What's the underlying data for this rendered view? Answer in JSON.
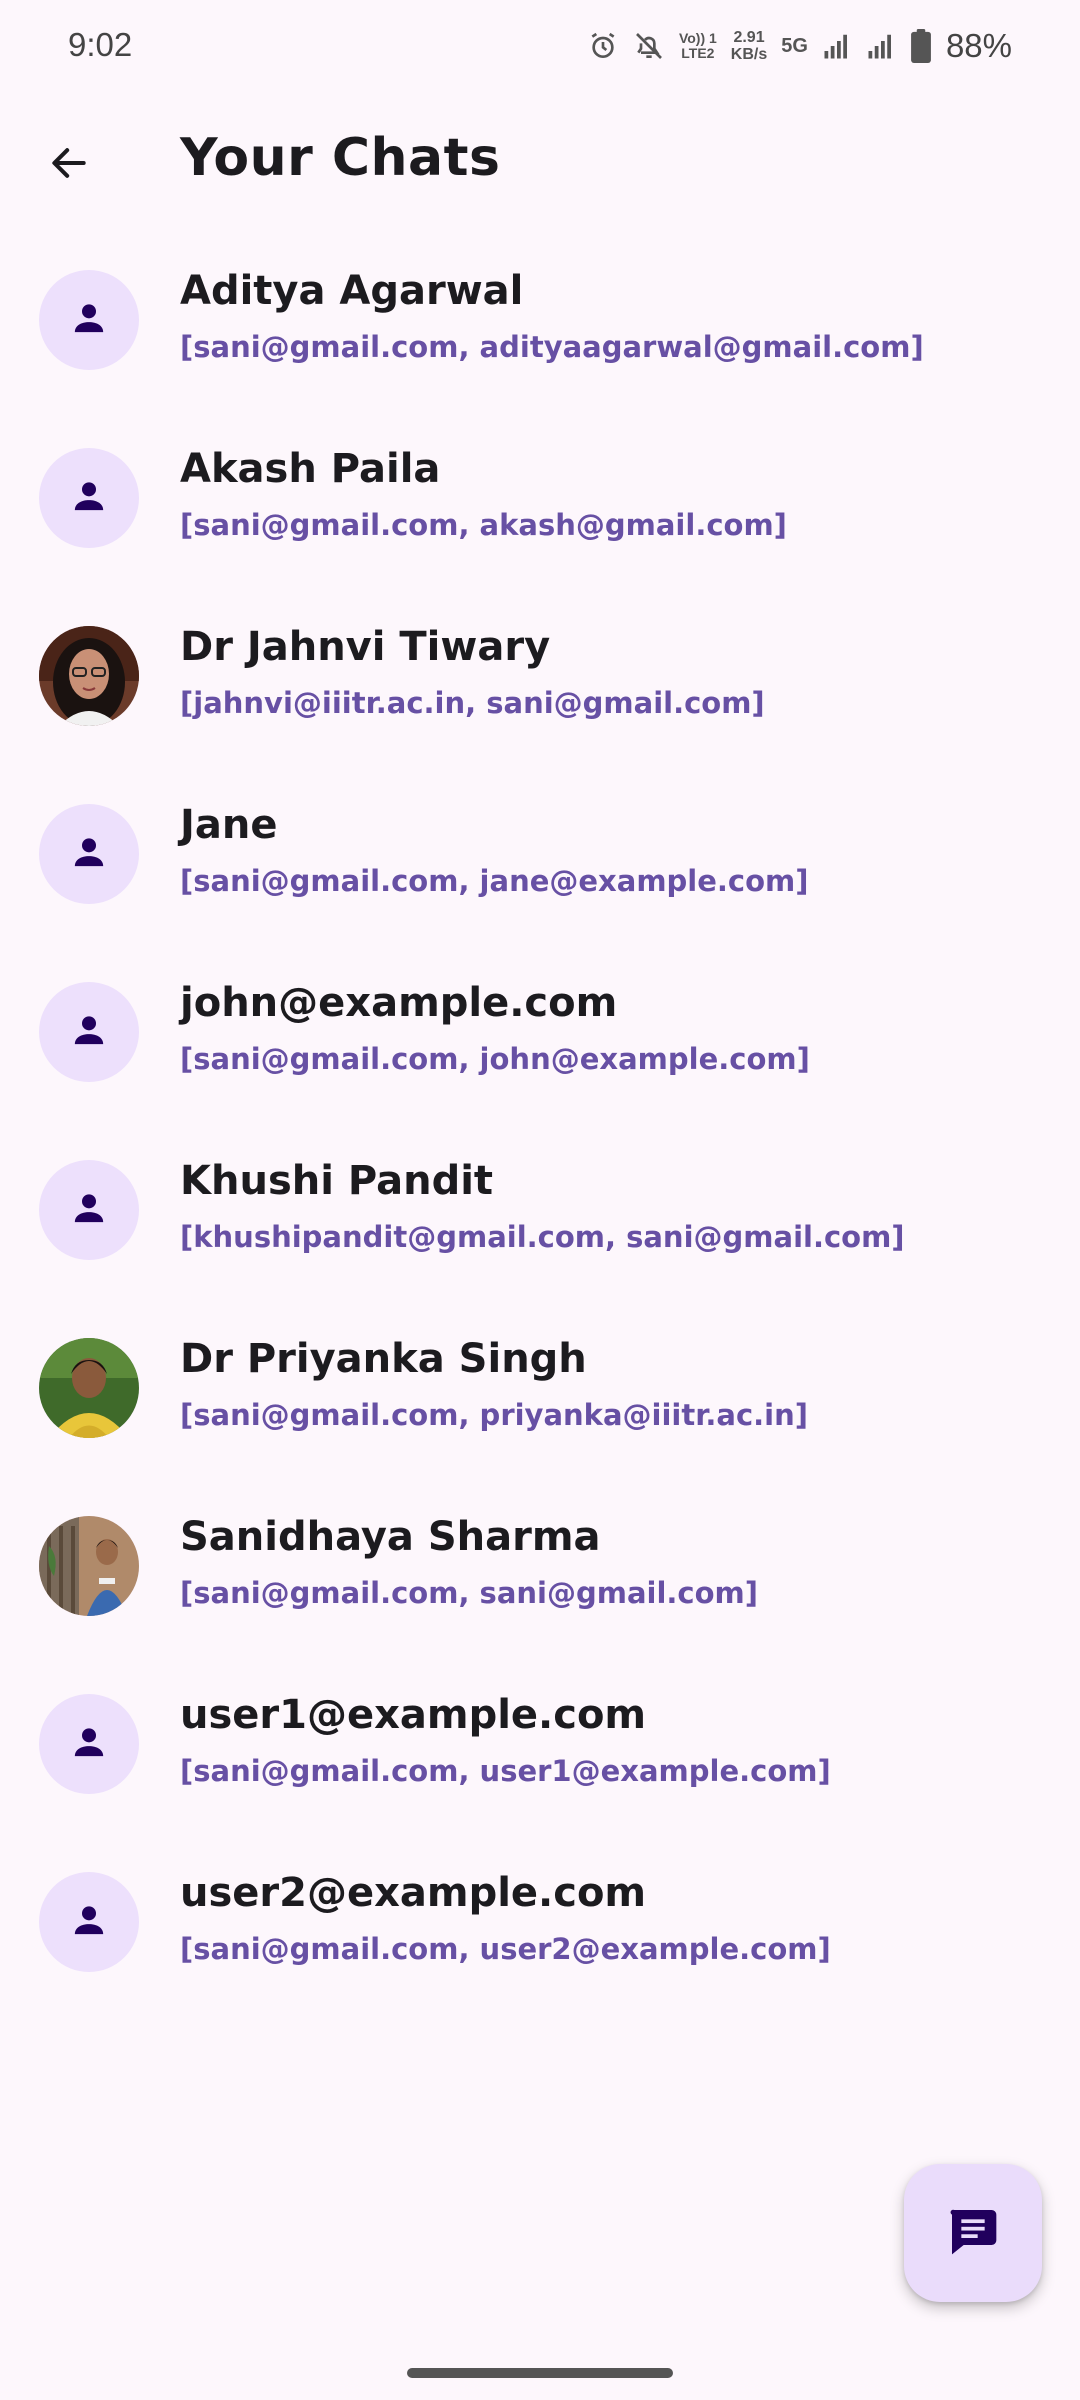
{
  "status_bar": {
    "time": "9:02",
    "volte_top": "Vo)) 1",
    "volte_bottom": "LTE2",
    "speed_value": "2.91",
    "speed_unit": "KB/s",
    "network": "5G",
    "battery": "88%"
  },
  "header": {
    "title": "Your Chats"
  },
  "chats": [
    {
      "name": "Aditya Agarwal",
      "participants": "[sani@gmail.com, adityaagarwal@gmail.com]",
      "avatar": "person-icon"
    },
    {
      "name": "Akash Paila",
      "participants": "[sani@gmail.com, akash@gmail.com]",
      "avatar": "person-icon"
    },
    {
      "name": "Dr Jahnvi Tiwary",
      "participants": "[jahnvi@iiitr.ac.in, sani@gmail.com]",
      "avatar": "photo"
    },
    {
      "name": "Jane",
      "participants": "[sani@gmail.com, jane@example.com]",
      "avatar": "person-icon"
    },
    {
      "name": "john@example.com",
      "participants": "[sani@gmail.com, john@example.com]",
      "avatar": "person-icon"
    },
    {
      "name": "Khushi Pandit",
      "participants": "[khushipandit@gmail.com, sani@gmail.com]",
      "avatar": "person-icon"
    },
    {
      "name": "Dr Priyanka Singh",
      "participants": "[sani@gmail.com, priyanka@iiitr.ac.in]",
      "avatar": "photo"
    },
    {
      "name": "Sanidhaya Sharma",
      "participants": "[sani@gmail.com, sani@gmail.com]",
      "avatar": "photo"
    },
    {
      "name": "user1@example.com",
      "participants": "[sani@gmail.com, user1@example.com]",
      "avatar": "person-icon"
    },
    {
      "name": "user2@example.com",
      "participants": "[sani@gmail.com, user2@example.com]",
      "avatar": "person-icon"
    }
  ],
  "fab": {
    "icon": "chat-icon"
  },
  "colors": {
    "background": "#fdf7fc",
    "accent": "#6750a4",
    "avatar_bg": "#ede0fc",
    "icon_dark": "#21005d",
    "fab_bg": "#eadcfb"
  }
}
